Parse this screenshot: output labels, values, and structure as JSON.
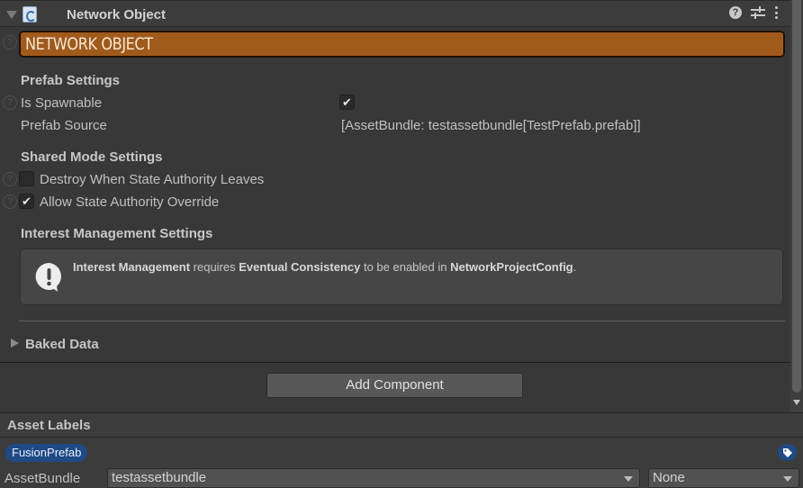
{
  "component": {
    "title": "Network Object",
    "banner": "NETWORK OBJECT",
    "header_icons": [
      "help-icon",
      "presets-icon",
      "context-menu-icon"
    ]
  },
  "prefab_settings": {
    "heading": "Prefab Settings",
    "is_spawnable": {
      "label": "Is Spawnable",
      "checked": true
    },
    "prefab_source": {
      "label": "Prefab Source",
      "value": "[AssetBundle: testassetbundle[TestPrefab.prefab]]"
    }
  },
  "shared_mode_settings": {
    "heading": "Shared Mode Settings",
    "destroy_when_leaves": {
      "label": "Destroy When State Authority Leaves",
      "checked": false
    },
    "allow_override": {
      "label": "Allow State Authority Override",
      "checked": true
    }
  },
  "interest_management": {
    "heading": "Interest Management Settings",
    "message": {
      "part1_bold": "Interest Management",
      "part2": " requires ",
      "part3_bold": "Eventual Consistency",
      "part4": " to be enabled in ",
      "part5_bold": "NetworkProjectConfig",
      "part6": "."
    }
  },
  "baked_data": {
    "label": "Baked Data",
    "expanded": false
  },
  "add_component": {
    "label": "Add Component"
  },
  "asset_labels": {
    "title": "Asset Labels",
    "labels": [
      "FusionPrefab"
    ],
    "asset_bundle_label": "AssetBundle",
    "asset_bundle_value": "testassetbundle",
    "variant_value": "None"
  },
  "colors": {
    "banner": "#a05a1c",
    "label_pill": "#1e4a86",
    "background": "#383838"
  }
}
